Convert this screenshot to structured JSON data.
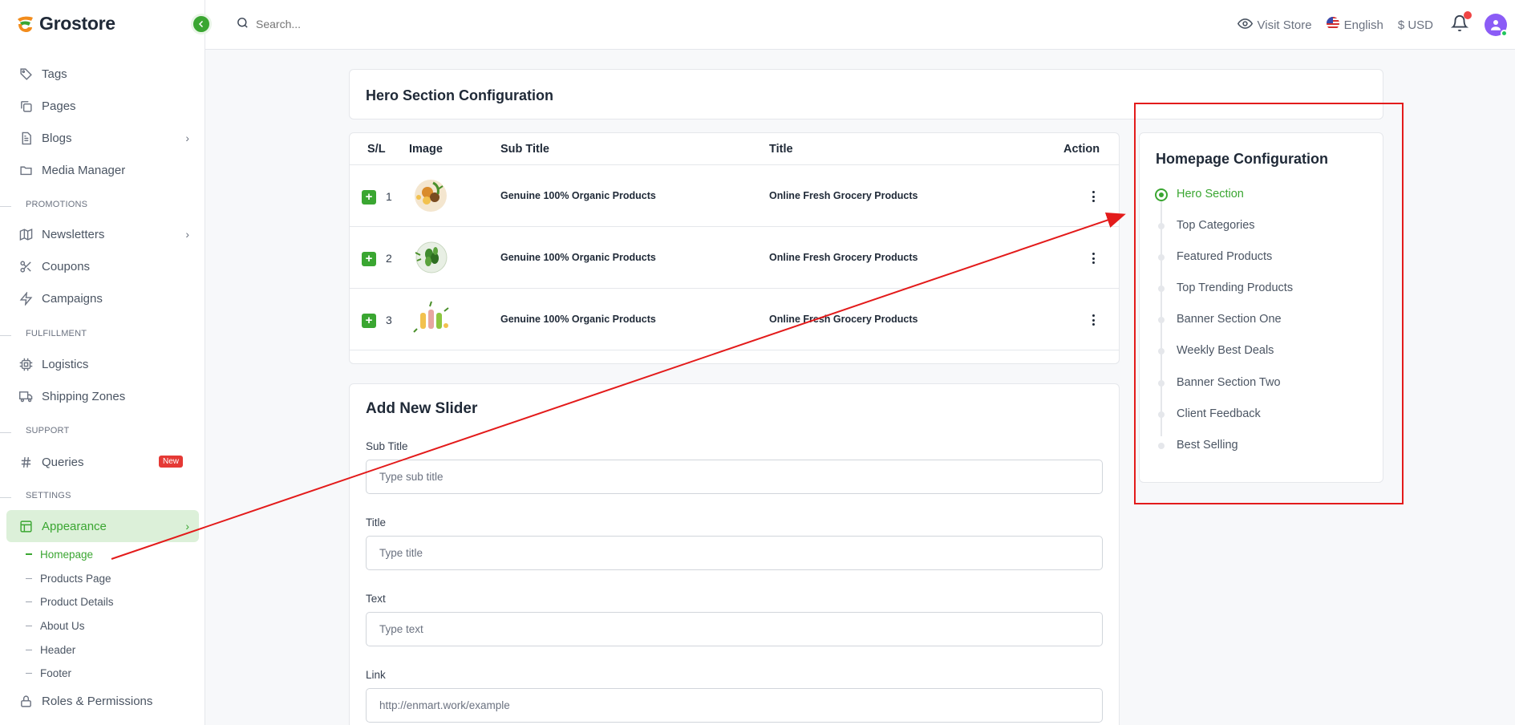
{
  "app": {
    "brand": "Grostore"
  },
  "topbar": {
    "search_placeholder": "Search...",
    "visit_store": "Visit Store",
    "language": "English",
    "currency": "$ USD"
  },
  "sidebar": {
    "items_top": [
      {
        "label": "Tags",
        "icon": "tag-icon"
      },
      {
        "label": "Pages",
        "icon": "pages-icon"
      },
      {
        "label": "Blogs",
        "icon": "document-icon"
      },
      {
        "label": "Media Manager",
        "icon": "folder-icon"
      }
    ],
    "sections": {
      "promotions": "PROMOTIONS",
      "fulfillment": "FULFILLMENT",
      "support": "SUPPORT",
      "settings": "SETTINGS"
    },
    "promotions_items": [
      {
        "label": "Newsletters",
        "icon": "map-icon"
      },
      {
        "label": "Coupons",
        "icon": "scissors-icon"
      },
      {
        "label": "Campaigns",
        "icon": "bolt-icon"
      }
    ],
    "fulfillment_items": [
      {
        "label": "Logistics",
        "icon": "chip-icon"
      },
      {
        "label": "Shipping Zones",
        "icon": "truck-icon"
      }
    ],
    "support_items": [
      {
        "label": "Queries",
        "icon": "hash-icon",
        "badge": "New"
      }
    ],
    "appearance": {
      "label": "Appearance",
      "icon": "layout-icon"
    },
    "appearance_sub": [
      "Homepage",
      "Products Page",
      "Product Details",
      "About Us",
      "Header",
      "Footer"
    ],
    "roles": {
      "label": "Roles & Permissions",
      "icon": "lock-icon"
    }
  },
  "hero": {
    "title": "Hero Section Configuration",
    "table": {
      "headers": [
        "S/L",
        "Image",
        "Sub Title",
        "Title",
        "Action"
      ],
      "rows": [
        {
          "sl": "1",
          "sub_title": "Genuine 100% Organic Products",
          "title": "Online Fresh Grocery Products"
        },
        {
          "sl": "2",
          "sub_title": "Genuine 100% Organic Products",
          "title": "Online Fresh Grocery Products"
        },
        {
          "sl": "3",
          "sub_title": "Genuine 100% Organic Products",
          "title": "Online Fresh Grocery Products"
        }
      ]
    }
  },
  "slider_form": {
    "title": "Add New Slider",
    "fields": [
      {
        "label": "Sub Title",
        "placeholder": "Type sub title"
      },
      {
        "label": "Title",
        "placeholder": "Type title"
      },
      {
        "label": "Text",
        "placeholder": "Type text"
      },
      {
        "label": "Link",
        "placeholder": "http://enmart.work/example"
      }
    ]
  },
  "homepage_config": {
    "title": "Homepage Configuration",
    "items": [
      "Hero Section",
      "Top Categories",
      "Featured Products",
      "Top Trending Products",
      "Banner Section One",
      "Weekly Best Deals",
      "Banner Section Two",
      "Client Feedback",
      "Best Selling"
    ]
  },
  "colors": {
    "accent": "#3aa631",
    "annotation": "#e31b1b",
    "badge": "#e53935"
  }
}
